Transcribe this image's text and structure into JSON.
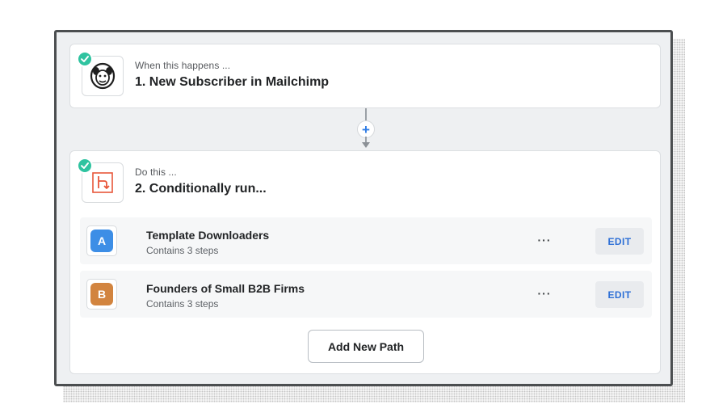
{
  "trigger": {
    "subtitle": "When this happens ...",
    "title": "1. New Subscriber in Mailchimp",
    "icon": "mailchimp-logo",
    "status": "complete"
  },
  "action": {
    "subtitle": "Do this ...",
    "title": "2. Conditionally run...",
    "icon": "paths-icon",
    "status": "complete",
    "paths": [
      {
        "badge": "A",
        "badge_color": "#3d8ee6",
        "name": "Template Downloaders",
        "meta": "Contains 3 steps",
        "more": "···",
        "edit": "EDIT"
      },
      {
        "badge": "B",
        "badge_color": "#d2843f",
        "name": "Founders of Small B2B Firms",
        "meta": "Contains 3 steps",
        "more": "···",
        "edit": "EDIT"
      }
    ],
    "add_path_label": "Add New Path"
  },
  "connector": {
    "add_symbol": "+"
  },
  "colors": {
    "accent": "#2d7be5",
    "check": "#2fc3a0",
    "paths_orange": "#e8563a"
  }
}
